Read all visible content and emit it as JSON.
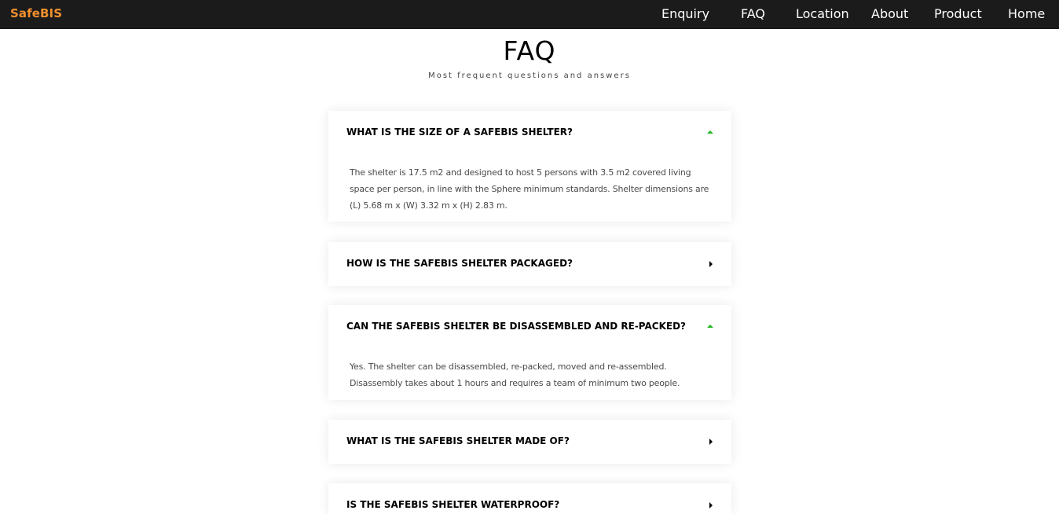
{
  "navbar": {
    "brand": "SafeBIS",
    "links": [
      "Enquiry",
      "FAQ",
      "Location",
      "About",
      "Product",
      "Home"
    ]
  },
  "header": {
    "title": "FAQ",
    "subtitle": "Most frequent questions and answers"
  },
  "faq": [
    {
      "question": "WHAT IS THE SIZE OF A SAFEBIS SHELTER?",
      "answer": "The shelter is 17.5 m2 and designed to host 5 persons with 3.5 m2 covered living space per person, in line with the Sphere minimum standards. Shelter dimensions are (L) 5.68 m x (W) 3.32 m x (H) 2.83 m.",
      "expanded": true,
      "icon": "chevron-up-icon"
    },
    {
      "question": "HOW IS THE SAFEBIS SHELTER PACKAGED?",
      "answer": "",
      "expanded": false,
      "icon": "chevron-right-icon"
    },
    {
      "question": "CAN THE SAFEBIS SHELTER BE DISASSEMBLED AND RE-PACKED?",
      "answer": "Yes. The shelter can be disassembled, re-packed, moved and re-assembled. Disassembly takes about 1 hours and requires a team of minimum two people.",
      "expanded": true,
      "icon": "chevron-up-icon"
    },
    {
      "question": "WHAT IS THE SAFEBIS SHELTER MADE OF?",
      "answer": "",
      "expanded": false,
      "icon": "chevron-right-icon"
    },
    {
      "question": "IS THE SAFEBIS SHELTER WATERPROOF?",
      "answer": "",
      "expanded": false,
      "icon": "chevron-right-icon"
    }
  ],
  "colors": {
    "navbar_bg": "#1b1b1b",
    "brand": "#f2902e",
    "expanded_arrow": "#22b822"
  }
}
